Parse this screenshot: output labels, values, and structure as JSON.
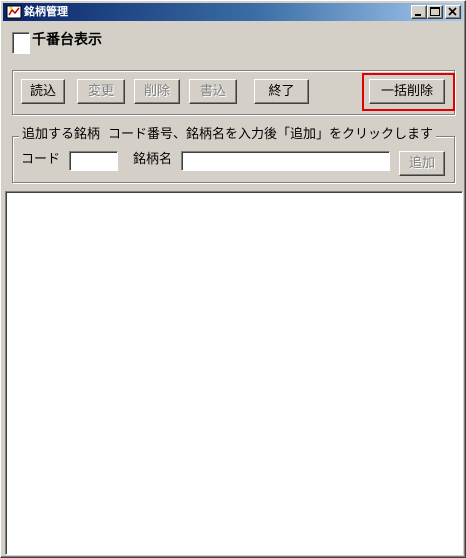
{
  "window": {
    "title": "銘柄管理",
    "icon": "app-icon"
  },
  "title_buttons": {
    "minimize_icon": "minimize-icon",
    "maximize_icon": "maximize-icon",
    "close_icon": "close-icon"
  },
  "options": {
    "thousands_label": "千番台表示",
    "thousands_checked": false
  },
  "toolbar": {
    "load_label": "読込",
    "change_label": "変更",
    "delete_label": "削除",
    "write_label": "書込",
    "exit_label": "終了",
    "bulk_delete_label": "一括削除"
  },
  "add_group": {
    "title": "追加する銘柄",
    "hint": "コード番号、銘柄名を入力後「追加」をクリックします",
    "code_label": "コード",
    "code_value": "",
    "name_label": "銘柄名",
    "name_value": "",
    "add_label": "追加"
  },
  "list": {
    "items": []
  },
  "colors": {
    "highlight": "#e00000",
    "titlebar_start": "#0a246a",
    "titlebar_end": "#a6caf0",
    "face": "#d4d0c8"
  }
}
